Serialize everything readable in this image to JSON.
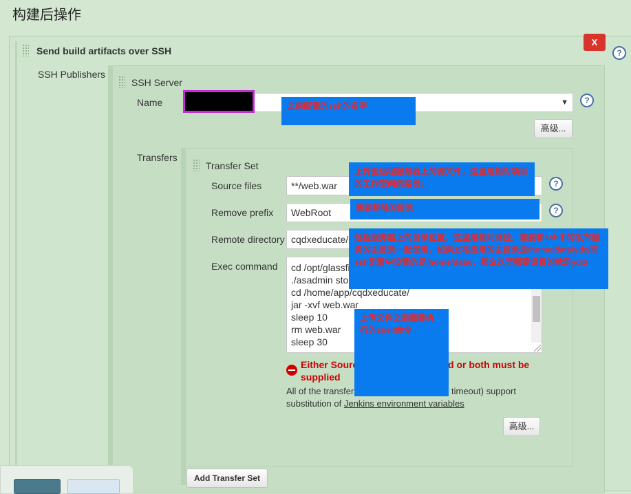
{
  "section": {
    "title": "构建后操作"
  },
  "publisher": {
    "title": "Send build artifacts over SSH",
    "delete_label": "X",
    "ssh_publishers_label": "SSH Publishers",
    "server": {
      "title": "SSH Server",
      "name_label": "Name",
      "name_value": "",
      "advanced_label": "高级..."
    },
    "transfers_label": "Transfers",
    "transfer_set": {
      "title": "Transfer Set",
      "source_files_label": "Source files",
      "source_files_value": "**/web.war",
      "remove_prefix_label": "Remove prefix",
      "remove_prefix_value": "WebRoot",
      "remote_dir_label": "Remote directory",
      "remote_dir_value": "cqdxeducate/",
      "exec_label": "Exec command",
      "exec_lines": [
        "cd /opt/glassfis",
        "./asadmin stop",
        "cd /home/app/cqdxeducate/",
        "jar -xvf web.war",
        "sleep 10",
        "rm web.war",
        "sleep 30"
      ],
      "error_line1": "Either Sourc",
      "error_line1_tail": "d or both must be",
      "error_line2": "supplied",
      "info_line1": "All of the transfer",
      "info_line1_tail": "timeout) support",
      "info_line2_prefix": "substitution of",
      "info_link": "Jenkins environment variables",
      "advanced_label": "高级..."
    },
    "add_transfer_label": "Add Transfer Set"
  },
  "annotations": {
    "name_note": "之前配置的ssh的名字",
    "source_note": "上传至远程服务器上的源文件，这里是相对项目的工作空间的路径；",
    "prefix_note": "需要移除的目录",
    "remote_note": "远程服务器上的目录位置，这里是相对路径，需要和ssh中的发布服务的主目录一起使用，如果发布应用的主目录是/home/data/ydx/而ssh配置中设置的是/home/data/，那么这里需要设置的就是ydx/",
    "exec_note": "上传文件之后需要执行的shell命令"
  },
  "colors": {
    "page_bg": "#d3e7d1",
    "panel_bg": "#c6dfc4",
    "note_bg": "#0a7bef",
    "note_text": "#e0292f",
    "delete_bg": "#d9342b",
    "error_text": "#d00000"
  },
  "icons": {
    "help": "question-icon",
    "error": "error-circle-icon",
    "drag": "drag-handle-icon",
    "dropdown": "caret-down-icon"
  }
}
